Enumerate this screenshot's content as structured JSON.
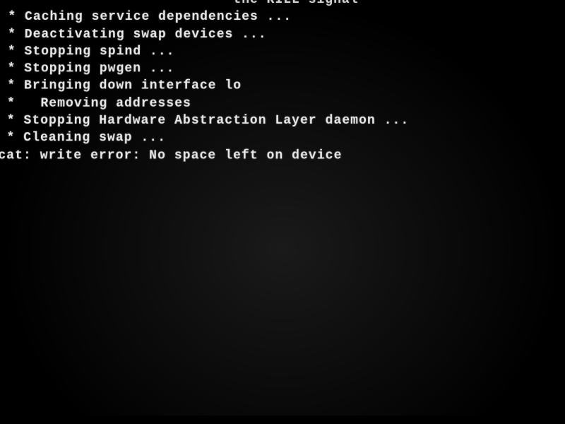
{
  "console": {
    "lines": [
      "                            the KILL signal",
      " * Caching service dependencies ...",
      " * Deactivating swap devices ...",
      " * Stopping spind ...",
      " * Stopping pwgen ...",
      " * Bringing down interface lo",
      " *   Removing addresses",
      " * Stopping Hardware Abstraction Layer daemon ...",
      " * Cleaning swap ...",
      "cat: write error: No space left on device"
    ]
  }
}
